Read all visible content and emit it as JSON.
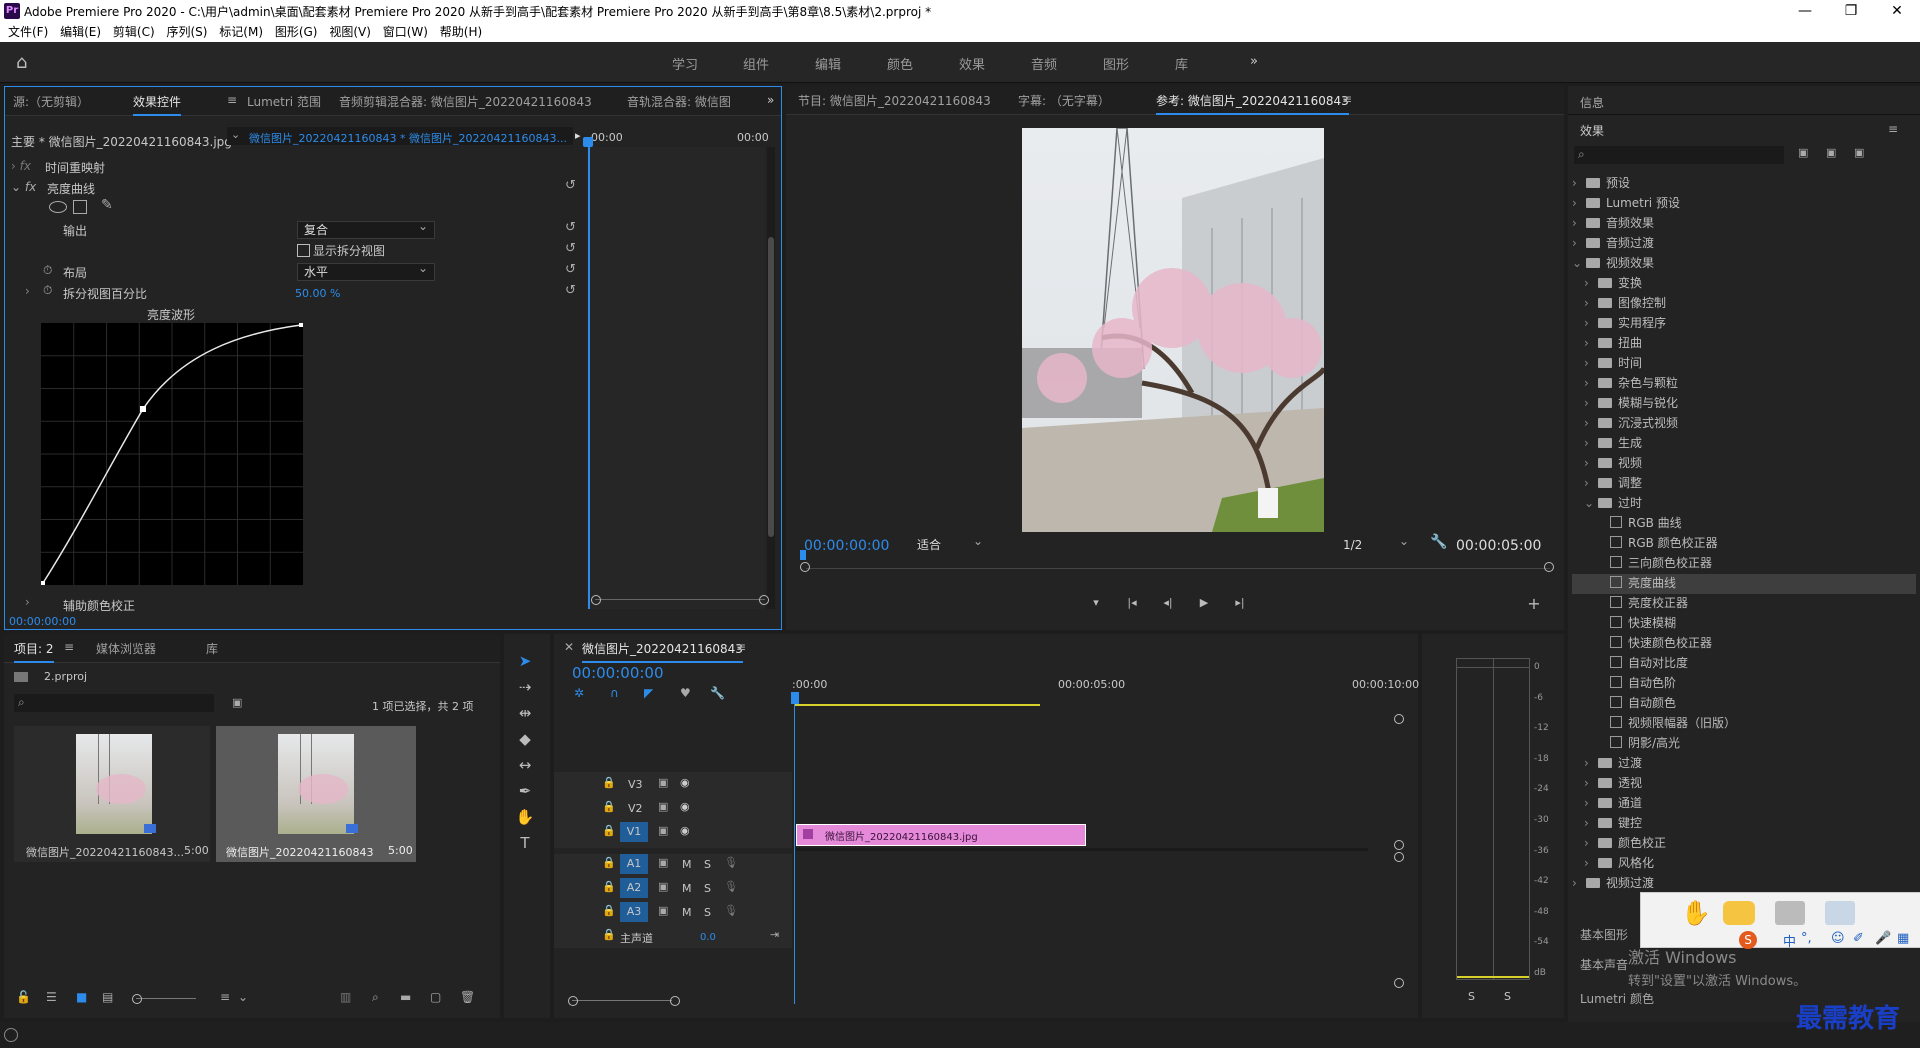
{
  "window": {
    "title": "Adobe Premiere Pro 2020 - C:\\用户\\admin\\桌面\\配套素材 Premiere Pro 2020 从新手到高手\\配套素材 Premiere Pro 2020 从新手到高手\\第8章\\8.5\\素材\\2.prproj *",
    "app_icon": "Pr"
  },
  "menu": [
    "文件(F)",
    "编辑(E)",
    "剪辑(C)",
    "序列(S)",
    "标记(M)",
    "图形(G)",
    "视图(V)",
    "窗口(W)",
    "帮助(H)"
  ],
  "workspaces": [
    "学习",
    "组件",
    "编辑",
    "颜色",
    "效果",
    "音频",
    "图形",
    "库"
  ],
  "source_panel": {
    "tabs": [
      "源:（无剪辑）",
      "效果控件",
      "Lumetri 范围",
      "音频剪辑混合器: 微信图片_20220421160843",
      "音轨混合器: 微信图"
    ],
    "master_label": "主要 * 微信图片_20220421160843.jpg",
    "clip_label": "微信图片_20220421160843 * 微信图片_20220421160843...",
    "time_start": "00:00",
    "time_end": "00:00",
    "rows": {
      "time_remap": "时间重映射",
      "luma_curves": "亮度曲线",
      "output_label": "输出",
      "output_value": "复合",
      "split_view": "显示拆分视图",
      "layout_label": "布局",
      "layout_value": "水平",
      "split_pct_label": "拆分视图百分比",
      "split_pct_value": "50.00 %",
      "waveform_title": "亮度波形",
      "aux_label": "辅助颜色校正"
    },
    "current_time": "00:00:00:00"
  },
  "program_panel": {
    "tabs": [
      "节目: 微信图片_20220421160843",
      "字幕: （无字幕）",
      "参考: 微信图片_20220421160843"
    ],
    "timecode": "00:00:00:00",
    "fit": "适合",
    "quality": "1/2",
    "duration": "00:00:05:00"
  },
  "right_panel": {
    "info": "信息",
    "effects": "效果",
    "tree": [
      {
        "label": "预设",
        "type": "folder",
        "level": 0
      },
      {
        "label": "Lumetri 预设",
        "type": "folder",
        "level": 0
      },
      {
        "label": "音频效果",
        "type": "folder",
        "level": 0
      },
      {
        "label": "音频过渡",
        "type": "folder",
        "level": 0
      },
      {
        "label": "视频效果",
        "type": "folder",
        "level": 0,
        "open": true
      },
      {
        "label": "变换",
        "type": "folder",
        "level": 1
      },
      {
        "label": "图像控制",
        "type": "folder",
        "level": 1
      },
      {
        "label": "实用程序",
        "type": "folder",
        "level": 1
      },
      {
        "label": "扭曲",
        "type": "folder",
        "level": 1
      },
      {
        "label": "时间",
        "type": "folder",
        "level": 1
      },
      {
        "label": "杂色与颗粒",
        "type": "folder",
        "level": 1
      },
      {
        "label": "模糊与锐化",
        "type": "folder",
        "level": 1
      },
      {
        "label": "沉浸式视频",
        "type": "folder",
        "level": 1
      },
      {
        "label": "生成",
        "type": "folder",
        "level": 1
      },
      {
        "label": "视频",
        "type": "folder",
        "level": 1
      },
      {
        "label": "调整",
        "type": "folder",
        "level": 1
      },
      {
        "label": "过时",
        "type": "folder",
        "level": 1,
        "open": true
      },
      {
        "label": "RGB 曲线",
        "type": "fx",
        "level": 2
      },
      {
        "label": "RGB 颜色校正器",
        "type": "fx",
        "level": 2
      },
      {
        "label": "三向颜色校正器",
        "type": "fx",
        "level": 2
      },
      {
        "label": "亮度曲线",
        "type": "fx",
        "level": 2,
        "selected": true
      },
      {
        "label": "亮度校正器",
        "type": "fx",
        "level": 2
      },
      {
        "label": "快速模糊",
        "type": "fx",
        "level": 2
      },
      {
        "label": "快速颜色校正器",
        "type": "fx",
        "level": 2
      },
      {
        "label": "自动对比度",
        "type": "fx",
        "level": 2
      },
      {
        "label": "自动色阶",
        "type": "fx",
        "level": 2
      },
      {
        "label": "自动颜色",
        "type": "fx",
        "level": 2
      },
      {
        "label": "视频限幅器（旧版）",
        "type": "fx",
        "level": 2
      },
      {
        "label": "阴影/高光",
        "type": "fx",
        "level": 2
      },
      {
        "label": "过渡",
        "type": "folder",
        "level": 1
      },
      {
        "label": "透视",
        "type": "folder",
        "level": 1
      },
      {
        "label": "通道",
        "type": "folder",
        "level": 1
      },
      {
        "label": "键控",
        "type": "folder",
        "level": 1
      },
      {
        "label": "颜色校正",
        "type": "folder",
        "level": 1
      },
      {
        "label": "风格化",
        "type": "folder",
        "level": 1
      },
      {
        "label": "视频过渡",
        "type": "folder",
        "level": 0
      }
    ],
    "bottom": [
      "基本图形",
      "基本声音",
      "Lumetri 颜色"
    ],
    "activate_line1": "激活 Windows",
    "activate_line2": "转到\"设置\"以激活 Windows。"
  },
  "project_panel": {
    "tabs": [
      "项目: 2",
      "媒体浏览器",
      "库"
    ],
    "file": "2.prproj",
    "selection": "1 项已选择，共 2 项",
    "items": [
      {
        "name": "微信图片_20220421160843...",
        "duration": "5:00"
      },
      {
        "name": "微信图片_20220421160843",
        "duration": "5:00"
      }
    ]
  },
  "timeline": {
    "tab": "微信图片_20220421160843",
    "timecode": "00:00:00:00",
    "ruler": [
      ":00:00",
      "00:00:05:00",
      "00:00:10:00"
    ],
    "video_tracks": [
      "V3",
      "V2",
      "V1"
    ],
    "audio_tracks": [
      "A1",
      "A2",
      "A3"
    ],
    "mute": "M",
    "solo": "S",
    "master": "主声道",
    "master_value": "0.0",
    "clip": "微信图片_20220421160843.jpg"
  },
  "meter": {
    "scale": [
      "0",
      "-6",
      "-12",
      "-18",
      "-24",
      "-30",
      "-36",
      "-42",
      "-48",
      "-54",
      "dB"
    ],
    "solo": [
      "S",
      "S"
    ]
  },
  "watermark": "最需教育",
  "ime_text": "中"
}
